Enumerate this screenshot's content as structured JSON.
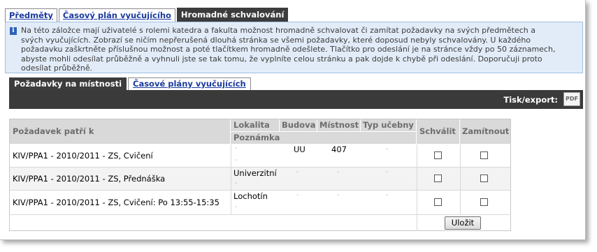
{
  "top_tabs": [
    {
      "label": "Předměty",
      "active": false
    },
    {
      "label": "Časový plán vyučujícího",
      "active": false
    },
    {
      "label": "Hromadné schvalování",
      "active": true
    }
  ],
  "info": {
    "icon": "info-icon",
    "line1": "Na této záložce mají uživatelé s rolemi katedra a fakulta možnost hromadně schvalovat či zamítat požadavky na svých předmětech a",
    "line2": "svých vyučujících. Zobrazí se ničím nepřerušená dlouhá stránka se všemi požadavky, které doposud nebyly schvalovány. U každého",
    "line3": "požadavku zaškrtněte příslušnou možnost a poté tlačítkem hromadně odešlete. Tlačítko pro odeslání je na stránce vždy po 50 záznamech,",
    "line4": "abyste mohli odesílat průběžně a vyhnuli jste se tak tomu, že vyplníte celou stránku a pak dojde k chybě při odeslání. Doporučuji proto",
    "line5": "odesílat průběžně."
  },
  "sub_tabs": [
    {
      "label": "Požadavky na místnosti",
      "active": true
    },
    {
      "label": "Časové plány vyučujících",
      "active": false
    }
  ],
  "export": {
    "label": "Tisk/export:",
    "icon": "pdf-icon",
    "icon_text": "PDF"
  },
  "table": {
    "headers": {
      "request": "Požadavek patří k",
      "locality": "Lokalita",
      "building": "Budova",
      "room": "Místnost",
      "room_type": "Typ učebny",
      "note": "Poznámka",
      "approve": "Schválit",
      "reject": "Zamítnout"
    },
    "rows": [
      {
        "request": "KIV/PPA1 - 2010/2011 - ZS, Cvičení",
        "locality": "-",
        "building": "UU",
        "room": "407",
        "room_type": "-",
        "note": "-",
        "approve": false,
        "reject": false
      },
      {
        "request": "KIV/PPA1 - 2010/2011 - ZS, Přednáška",
        "locality": "Univerzitní",
        "building": "-",
        "room": "-",
        "room_type": "-",
        "note": "-",
        "approve": false,
        "reject": false
      },
      {
        "request": "KIV/PPA1 - 2010/2011 - ZS, Cvičení: Po 13:55-15:35",
        "locality": "Lochotín",
        "building": "-",
        "room": "-",
        "room_type": "-",
        "note": "-",
        "approve": false,
        "reject": false
      }
    ],
    "submit_label": "Uložit"
  },
  "colors": {
    "dark_bar": "#3a3a3a",
    "link": "#1a3b9e",
    "info_bg": "#e2ecf8",
    "header_bg": "#d9d9d9"
  }
}
